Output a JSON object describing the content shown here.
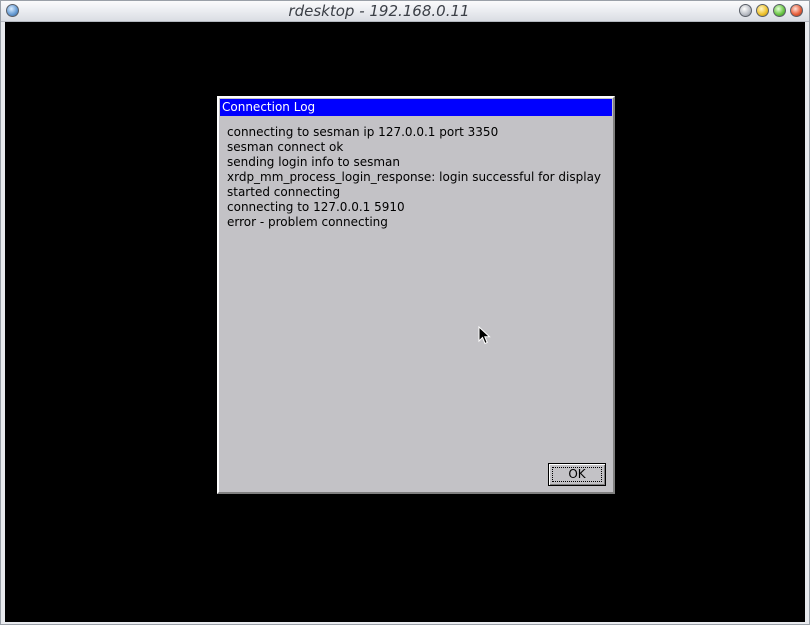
{
  "window": {
    "title": "rdesktop - 192.168.0.11"
  },
  "dialog": {
    "title": "Connection Log",
    "log_lines": [
      "connecting to sesman ip 127.0.0.1 port 3350",
      "sesman connect ok",
      "sending login info to sesman",
      "xrdp_mm_process_login_response: login successful for display",
      "started connecting",
      "connecting to 127.0.0.1 5910",
      "error - problem connecting"
    ],
    "ok_label": "OK"
  },
  "colors": {
    "dialog_title_bg": "#0000ff",
    "dialog_bg": "#c3c2c6",
    "desktop_bg": "#000000"
  },
  "icons": {
    "window_menu": "window-menu-icon",
    "minimize": "minimize-icon",
    "shade": "shade-icon",
    "maximize": "maximize-icon",
    "close": "close-icon",
    "cursor": "mouse-pointer-icon"
  }
}
